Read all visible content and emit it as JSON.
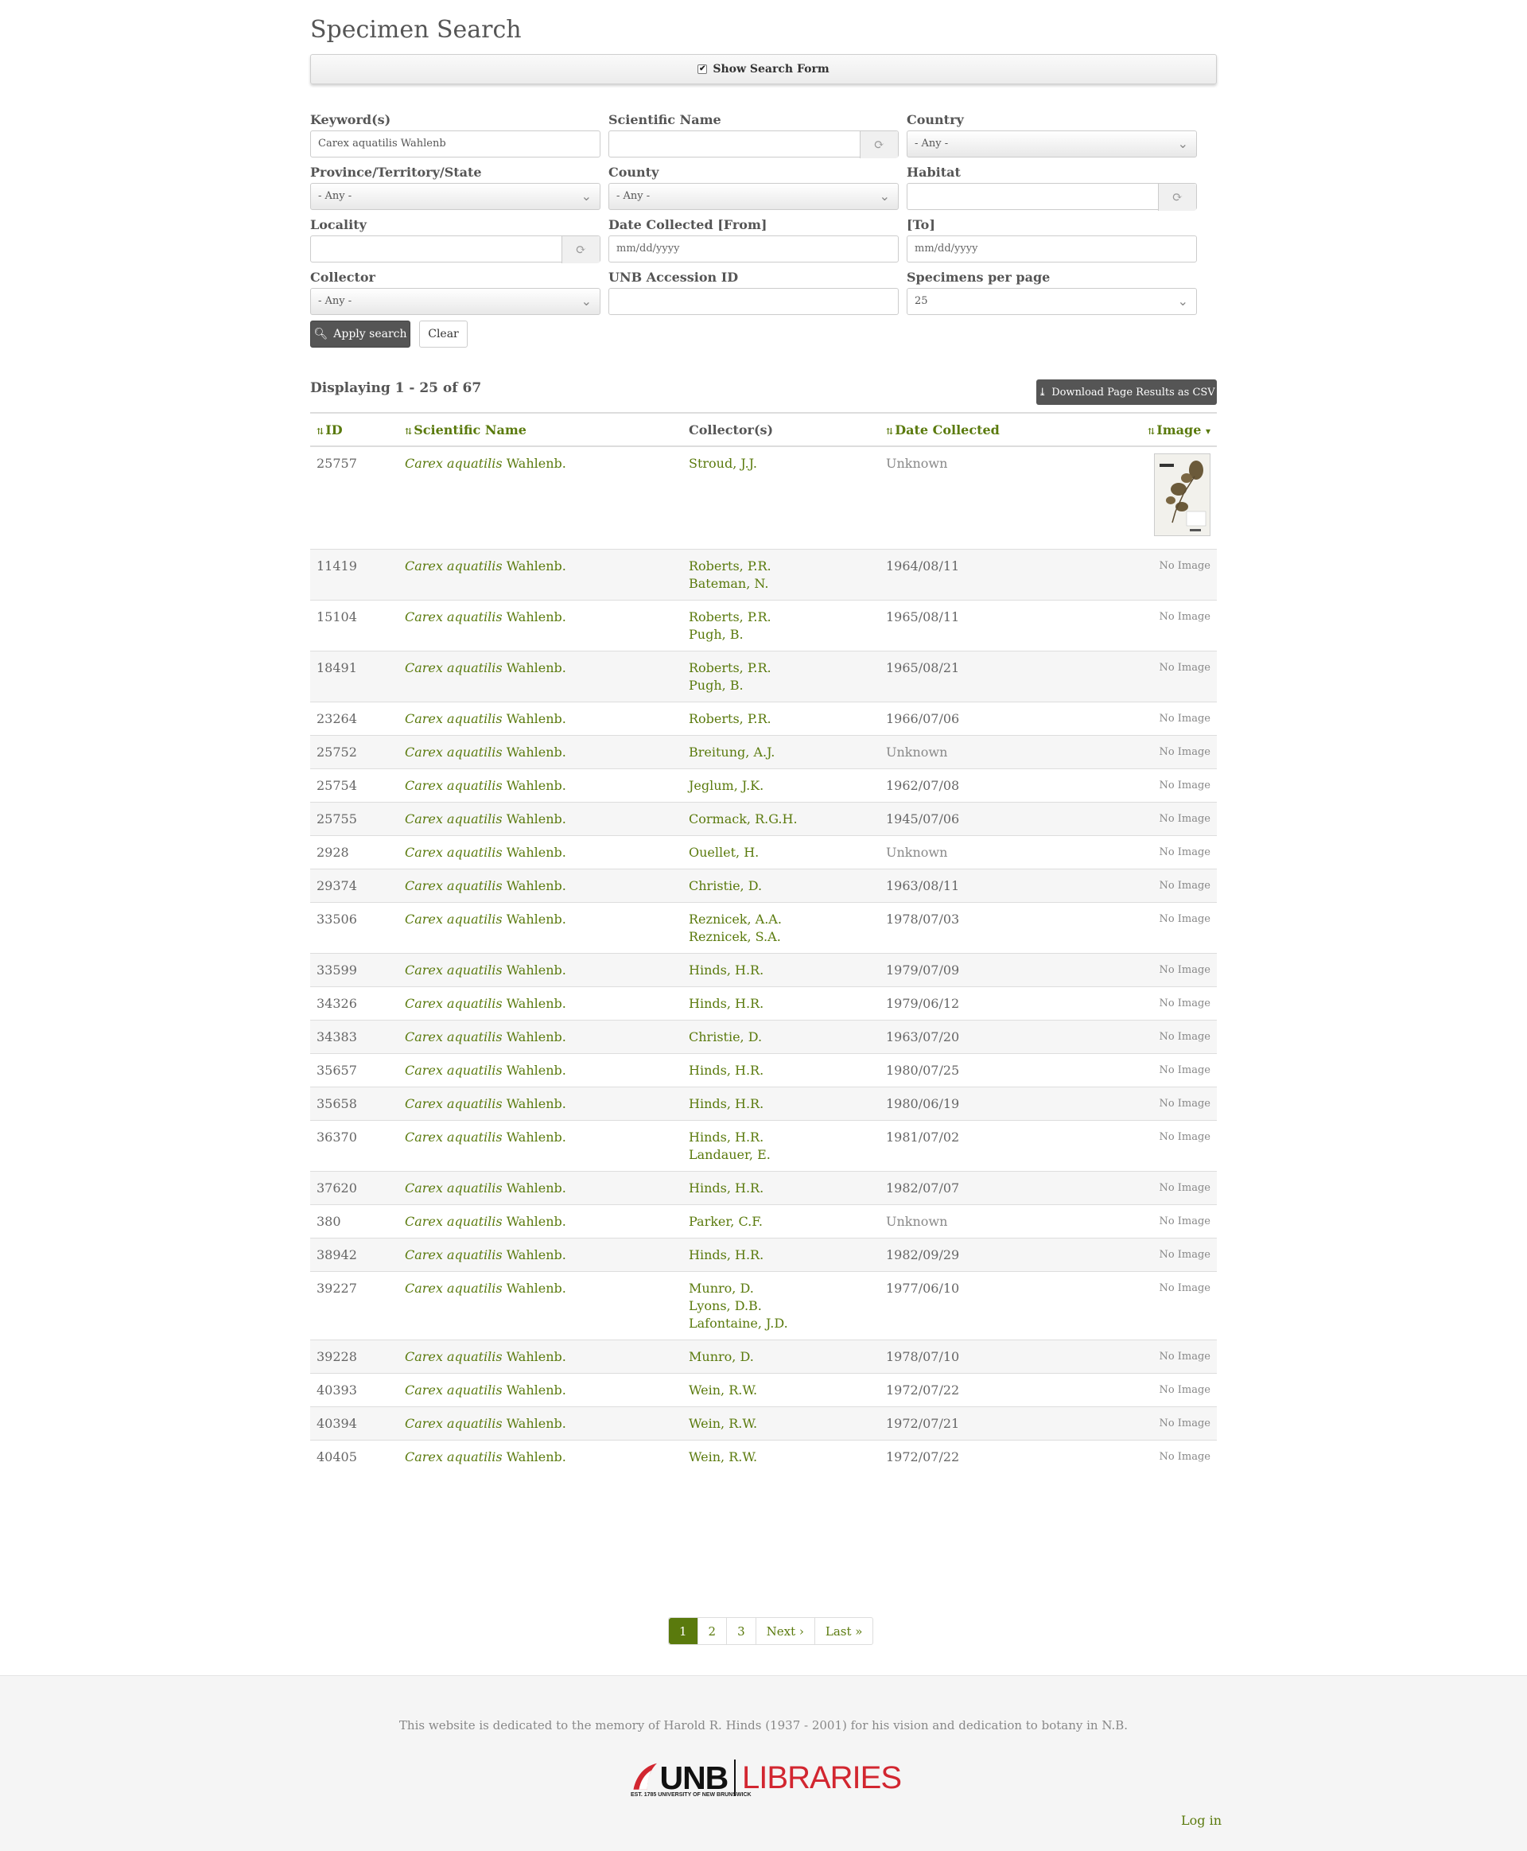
{
  "page_title": "Specimen Search",
  "search_toggle": {
    "label": "Show Search Form",
    "checked": true
  },
  "form": {
    "keyword": {
      "label": "Keyword(s)",
      "value": "Carex aquatilis Wahlenb"
    },
    "scientific_name": {
      "label": "Scientific Name",
      "value": ""
    },
    "country": {
      "label": "Country",
      "value": "- Any -"
    },
    "province": {
      "label": "Province/Territory/State",
      "value": "- Any -"
    },
    "county": {
      "label": "County",
      "value": "- Any -"
    },
    "habitat": {
      "label": "Habitat",
      "value": ""
    },
    "locality": {
      "label": "Locality",
      "value": ""
    },
    "date_from": {
      "label": "Date Collected [From]",
      "placeholder": "mm/dd/yyyy"
    },
    "date_to": {
      "label": "[To]",
      "placeholder": "mm/dd/yyyy"
    },
    "collector": {
      "label": "Collector",
      "value": "- Any -"
    },
    "accession": {
      "label": "UNB Accession ID",
      "value": ""
    },
    "per_page": {
      "label": "Specimens per page",
      "value": "25"
    },
    "apply_label": "Apply search",
    "clear_label": "Clear"
  },
  "results": {
    "summary": "Displaying 1 - 25 of 67",
    "csv_label": "Download Page Results as CSV",
    "columns": [
      "ID",
      "Scientific Name",
      "Collector(s)",
      "Date Collected",
      "Image"
    ],
    "no_image_label": "No Image",
    "rows": [
      {
        "id": "25757",
        "genus_species": "Carex aquatilis",
        "author": "Wahlenb.",
        "collectors": [
          "Stroud, J.J."
        ],
        "date": "Unknown",
        "has_image": true
      },
      {
        "id": "11419",
        "genus_species": "Carex aquatilis",
        "author": "Wahlenb.",
        "collectors": [
          "Roberts, P.R.",
          "Bateman, N."
        ],
        "date": "1964/08/11",
        "has_image": false
      },
      {
        "id": "15104",
        "genus_species": "Carex aquatilis",
        "author": "Wahlenb.",
        "collectors": [
          "Roberts, P.R.",
          "Pugh, B."
        ],
        "date": "1965/08/11",
        "has_image": false
      },
      {
        "id": "18491",
        "genus_species": "Carex aquatilis",
        "author": "Wahlenb.",
        "collectors": [
          "Roberts, P.R.",
          "Pugh, B."
        ],
        "date": "1965/08/21",
        "has_image": false
      },
      {
        "id": "23264",
        "genus_species": "Carex aquatilis",
        "author": "Wahlenb.",
        "collectors": [
          "Roberts, P.R."
        ],
        "date": "1966/07/06",
        "has_image": false
      },
      {
        "id": "25752",
        "genus_species": "Carex aquatilis",
        "author": "Wahlenb.",
        "collectors": [
          "Breitung, A.J."
        ],
        "date": "Unknown",
        "has_image": false
      },
      {
        "id": "25754",
        "genus_species": "Carex aquatilis",
        "author": "Wahlenb.",
        "collectors": [
          "Jeglum, J.K."
        ],
        "date": "1962/07/08",
        "has_image": false
      },
      {
        "id": "25755",
        "genus_species": "Carex aquatilis",
        "author": "Wahlenb.",
        "collectors": [
          "Cormack, R.G.H."
        ],
        "date": "1945/07/06",
        "has_image": false
      },
      {
        "id": "2928",
        "genus_species": "Carex aquatilis",
        "author": "Wahlenb.",
        "collectors": [
          "Ouellet, H."
        ],
        "date": "Unknown",
        "has_image": false
      },
      {
        "id": "29374",
        "genus_species": "Carex aquatilis",
        "author": "Wahlenb.",
        "collectors": [
          "Christie, D."
        ],
        "date": "1963/08/11",
        "has_image": false
      },
      {
        "id": "33506",
        "genus_species": "Carex aquatilis",
        "author": "Wahlenb.",
        "collectors": [
          "Reznicek, A.A.",
          "Reznicek, S.A."
        ],
        "date": "1978/07/03",
        "has_image": false
      },
      {
        "id": "33599",
        "genus_species": "Carex aquatilis",
        "author": "Wahlenb.",
        "collectors": [
          "Hinds, H.R."
        ],
        "date": "1979/07/09",
        "has_image": false
      },
      {
        "id": "34326",
        "genus_species": "Carex aquatilis",
        "author": "Wahlenb.",
        "collectors": [
          "Hinds, H.R."
        ],
        "date": "1979/06/12",
        "has_image": false
      },
      {
        "id": "34383",
        "genus_species": "Carex aquatilis",
        "author": "Wahlenb.",
        "collectors": [
          "Christie, D."
        ],
        "date": "1963/07/20",
        "has_image": false
      },
      {
        "id": "35657",
        "genus_species": "Carex aquatilis",
        "author": "Wahlenb.",
        "collectors": [
          "Hinds, H.R."
        ],
        "date": "1980/07/25",
        "has_image": false
      },
      {
        "id": "35658",
        "genus_species": "Carex aquatilis",
        "author": "Wahlenb.",
        "collectors": [
          "Hinds, H.R."
        ],
        "date": "1980/06/19",
        "has_image": false
      },
      {
        "id": "36370",
        "genus_species": "Carex aquatilis",
        "author": "Wahlenb.",
        "collectors": [
          "Hinds, H.R.",
          "Landauer, E."
        ],
        "date": "1981/07/02",
        "has_image": false
      },
      {
        "id": "37620",
        "genus_species": "Carex aquatilis",
        "author": "Wahlenb.",
        "collectors": [
          "Hinds, H.R."
        ],
        "date": "1982/07/07",
        "has_image": false
      },
      {
        "id": "380",
        "genus_species": "Carex aquatilis",
        "author": "Wahlenb.",
        "collectors": [
          "Parker, C.F."
        ],
        "date": "Unknown",
        "has_image": false
      },
      {
        "id": "38942",
        "genus_species": "Carex aquatilis",
        "author": "Wahlenb.",
        "collectors": [
          "Hinds, H.R."
        ],
        "date": "1982/09/29",
        "has_image": false
      },
      {
        "id": "39227",
        "genus_species": "Carex aquatilis",
        "author": "Wahlenb.",
        "collectors": [
          "Munro, D.",
          "Lyons, D.B.",
          "Lafontaine, J.D."
        ],
        "date": "1977/06/10",
        "has_image": false
      },
      {
        "id": "39228",
        "genus_species": "Carex aquatilis",
        "author": "Wahlenb.",
        "collectors": [
          "Munro, D."
        ],
        "date": "1978/07/10",
        "has_image": false
      },
      {
        "id": "40393",
        "genus_species": "Carex aquatilis",
        "author": "Wahlenb.",
        "collectors": [
          "Wein, R.W."
        ],
        "date": "1972/07/22",
        "has_image": false
      },
      {
        "id": "40394",
        "genus_species": "Carex aquatilis",
        "author": "Wahlenb.",
        "collectors": [
          "Wein, R.W."
        ],
        "date": "1972/07/21",
        "has_image": false
      },
      {
        "id": "40405",
        "genus_species": "Carex aquatilis",
        "author": "Wahlenb.",
        "collectors": [
          "Wein, R.W."
        ],
        "date": "1972/07/22",
        "has_image": false
      }
    ]
  },
  "pager": {
    "pages": [
      "1",
      "2",
      "3"
    ],
    "active": "1",
    "next": "Next ›",
    "last": "Last »"
  },
  "footer": {
    "dedication": "This website is dedicated to the memory of Harold R. Hinds (1937 - 2001) for his vision and dedication to botany in N.B.",
    "logo_unb": "UNB",
    "logo_sub": "EST. 1785  UNIVERSITY OF NEW BRUNSWICK",
    "logo_libraries": "LIBRARIES",
    "login": "Log in"
  },
  "colors": {
    "link_green": "#5a7a0d",
    "button_dark": "#555555",
    "unb_red": "#d22630"
  }
}
